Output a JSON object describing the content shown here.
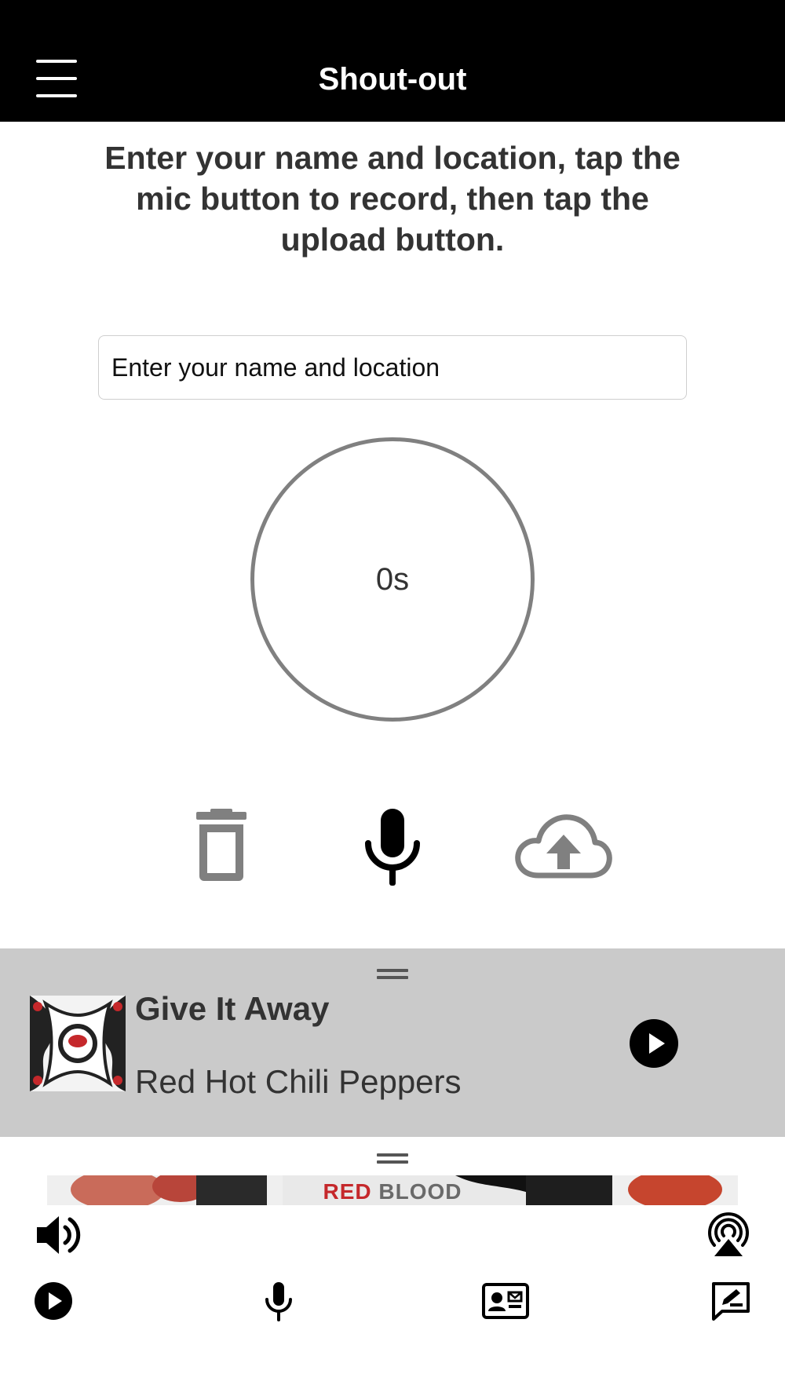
{
  "header": {
    "title": "Shout-out"
  },
  "instructions": "Enter your name and location, tap the mic button to record, then tap the upload button.",
  "name_input": {
    "placeholder": "Enter your name and location",
    "value": ""
  },
  "timer": {
    "label": "0s"
  },
  "controls": {
    "delete_icon": "trash-icon",
    "record_icon": "microphone-icon",
    "upload_icon": "cloud-upload-icon"
  },
  "now_playing": {
    "title": "Give It Away",
    "artist": "Red Hot Chili Peppers",
    "play_icon": "play-icon"
  },
  "banner": {
    "word1": "RED",
    "word2": "BLOOD"
  },
  "bottom_bar": {
    "left_top_icon": "volume-icon",
    "right_top_icon": "airplay-icon",
    "tabs": [
      "play-icon",
      "microphone-icon",
      "contact-card-icon",
      "message-edit-icon"
    ]
  },
  "colors": {
    "header_bg": "#000000",
    "player_bg": "#cacaca",
    "circle_border": "#808080",
    "banner_red": "#c5282b"
  }
}
